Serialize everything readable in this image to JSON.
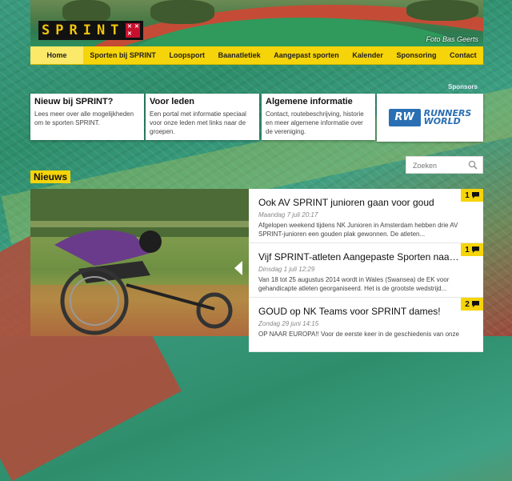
{
  "header": {
    "logo": "SPRINT",
    "photo_credit": "Foto Bas Geerts"
  },
  "nav": {
    "items": [
      {
        "label": "Home",
        "active": true
      },
      {
        "label": "Sporten bij SPRINT"
      },
      {
        "label": "Loopsport"
      },
      {
        "label": "Baanatletiek"
      },
      {
        "label": "Aangepast sporten"
      },
      {
        "label": "Kalender"
      },
      {
        "label": "Sponsoring"
      },
      {
        "label": "Contact"
      }
    ]
  },
  "sponsors_label": "Sponsors",
  "cards": [
    {
      "title": "Nieuw bij SPRINT?",
      "text": "Lees meer over alle mogelijkheden om te sporten SPRINT."
    },
    {
      "title": "Voor leden",
      "text": "Een portal met informatie speciaal voor onze leden met links naar de groepen."
    },
    {
      "title": "Algemene informatie",
      "text": "Contact, routebeschrijving, historie en meer algemene informatie over de vereniging."
    }
  ],
  "sponsor": {
    "mark": "RW",
    "line1": "RUNNERS",
    "line2": "WORLD"
  },
  "search": {
    "placeholder": "Zoeken"
  },
  "news": {
    "heading": "Nieuws",
    "items": [
      {
        "title": "Ook AV SPRINT junioren gaan voor goud",
        "date": "Maandag 7 juli 20:17",
        "excerpt": "Afgelopen weekend tijdens NK Junioren in Amsterdam hebben drie AV SPRINT-junioren een gouden plak gewonnen. De atleten...",
        "comments": "1"
      },
      {
        "title": "Vijf SPRINT-atleten Aangepaste Sporten naar EK in ...",
        "date": "Dinsdag 1 juli 12:29",
        "excerpt": "Van 18 tot 25 augustus 2014 wordt in Wales (Swansea) de EK voor gehandicapte atleten georganiseerd. Het is de grootste wedstrijd...",
        "comments": "1"
      },
      {
        "title": "GOUD op NK Teams voor SPRINT dames!",
        "date": "Zondag 29 juni 14:15",
        "excerpt": "OP NAAR EUROPA!! Voor de eerste keer in de geschiedenis van onze",
        "comments": "2"
      }
    ]
  },
  "colors": {
    "accent": "#f6d40a",
    "brand_red": "#c8102e",
    "sponsor_blue": "#2a6fb3"
  }
}
